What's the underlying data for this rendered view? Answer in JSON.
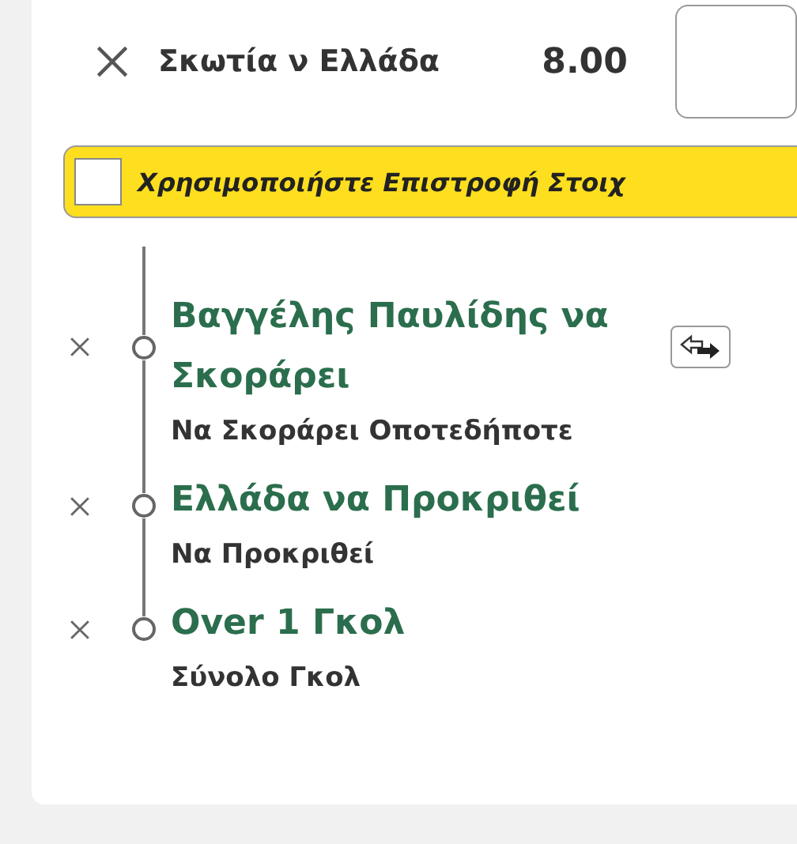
{
  "selection": {
    "title": "Σκωτία ν Ελλάδα",
    "odds": "8.00"
  },
  "bet_return": {
    "label": "Χρησιμοποιήστε Επιστροφή Στοιχ",
    "checked": false
  },
  "legs": [
    {
      "title": "Βαγγέλης Παυλίδης να Σκοράρει",
      "market": "Να Σκοράρει Οποτεδήποτε",
      "swappable": true
    },
    {
      "title": "Ελλάδα να Προκριθεί",
      "market": "Να Προκριθεί",
      "swappable": false
    },
    {
      "title": "Over 1 Γκολ",
      "market": "Σύνολο Γκολ",
      "swappable": false
    }
  ]
}
